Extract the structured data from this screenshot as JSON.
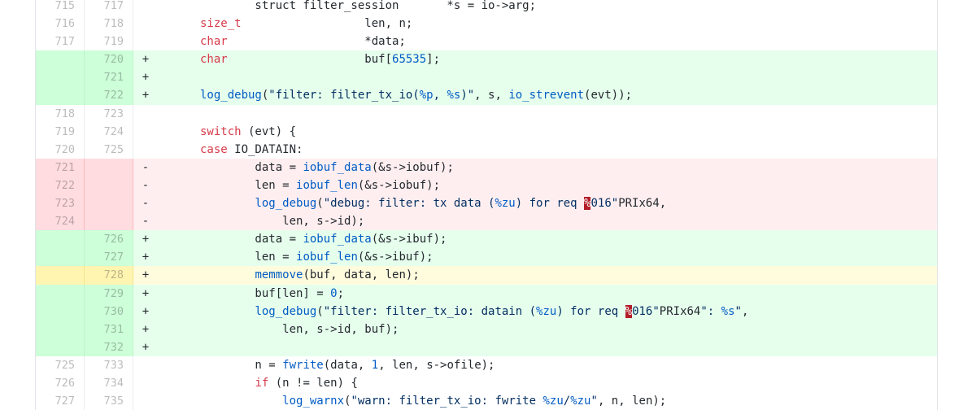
{
  "diff": {
    "rows": [
      {
        "type": "ctx",
        "old": "715",
        "new": "717",
        "marker": "",
        "tokens": [
          [
            "t",
            "        struct filter_session       *s = io->arg;"
          ]
        ]
      },
      {
        "type": "ctx",
        "old": "716",
        "new": "718",
        "marker": "",
        "tokens": [
          [
            "ty",
            "size_t"
          ],
          [
            "t",
            "                  len, n;"
          ]
        ]
      },
      {
        "type": "ctx",
        "old": "717",
        "new": "719",
        "marker": "",
        "tokens": [
          [
            "ty",
            "char"
          ],
          [
            "t",
            "                    *data;"
          ]
        ]
      },
      {
        "type": "add",
        "old": "",
        "new": "720",
        "marker": "+",
        "tokens": [
          [
            "ty",
            "char"
          ],
          [
            "t",
            "                    buf["
          ],
          [
            "n",
            "65535"
          ],
          [
            "t",
            "];"
          ]
        ]
      },
      {
        "type": "add",
        "old": "",
        "new": "721",
        "marker": "+",
        "tokens": [
          [
            "t",
            ""
          ]
        ]
      },
      {
        "type": "add",
        "old": "",
        "new": "722",
        "marker": "+",
        "tokens": [
          [
            "fn",
            "log_debug"
          ],
          [
            "t",
            "("
          ],
          [
            "s",
            "\"filter: filter_tx_io("
          ],
          [
            "n",
            "%p"
          ],
          [
            "s",
            ", "
          ],
          [
            "n",
            "%s"
          ],
          [
            "s",
            ")\""
          ],
          [
            "t",
            ", s, "
          ],
          [
            "fn",
            "io_strevent"
          ],
          [
            "t",
            "(evt));"
          ]
        ]
      },
      {
        "type": "ctx",
        "old": "718",
        "new": "723",
        "marker": "",
        "tokens": [
          [
            "t",
            ""
          ]
        ]
      },
      {
        "type": "ctx",
        "old": "719",
        "new": "724",
        "marker": "",
        "tokens": [
          [
            "k",
            "switch"
          ],
          [
            "t",
            " (evt) {"
          ]
        ]
      },
      {
        "type": "ctx",
        "old": "720",
        "new": "725",
        "marker": "",
        "tokens": [
          [
            "k",
            "case"
          ],
          [
            "t",
            " IO_DATAIN:"
          ]
        ]
      },
      {
        "type": "del",
        "old": "721",
        "new": "",
        "marker": "-",
        "tokens": [
          [
            "t",
            "        data = "
          ],
          [
            "fn",
            "iobuf_data"
          ],
          [
            "t",
            "(&s->iobuf);"
          ]
        ]
      },
      {
        "type": "del",
        "old": "722",
        "new": "",
        "marker": "-",
        "tokens": [
          [
            "t",
            "        len = "
          ],
          [
            "fn",
            "iobuf_len"
          ],
          [
            "t",
            "(&s->iobuf);"
          ]
        ]
      },
      {
        "type": "del",
        "old": "723",
        "new": "",
        "marker": "-",
        "tokens": [
          [
            "t",
            "        "
          ],
          [
            "fn",
            "log_debug"
          ],
          [
            "t",
            "("
          ],
          [
            "s",
            "\"debug: filter: tx data ("
          ],
          [
            "n",
            "%zu"
          ],
          [
            "s",
            ") for req "
          ],
          [
            "err",
            "%"
          ],
          [
            "s",
            "016\""
          ],
          [
            "t",
            "PRIx64,"
          ]
        ]
      },
      {
        "type": "del",
        "old": "724",
        "new": "",
        "marker": "-",
        "tokens": [
          [
            "t",
            "            len, s->id);"
          ]
        ]
      },
      {
        "type": "add",
        "old": "",
        "new": "726",
        "marker": "+",
        "tokens": [
          [
            "t",
            "        data = "
          ],
          [
            "fn",
            "iobuf_data"
          ],
          [
            "t",
            "(&s->ibuf);"
          ]
        ]
      },
      {
        "type": "add",
        "old": "",
        "new": "727",
        "marker": "+",
        "tokens": [
          [
            "t",
            "        len = "
          ],
          [
            "fn",
            "iobuf_len"
          ],
          [
            "t",
            "(&s->ibuf);"
          ]
        ]
      },
      {
        "type": "sel",
        "old": "",
        "new": "728",
        "marker": "+",
        "tokens": [
          [
            "t",
            "        "
          ],
          [
            "fn",
            "memmove"
          ],
          [
            "t",
            "(buf, data, len);"
          ]
        ]
      },
      {
        "type": "add",
        "old": "",
        "new": "729",
        "marker": "+",
        "tokens": [
          [
            "t",
            "        buf[len] = "
          ],
          [
            "n",
            "0"
          ],
          [
            "t",
            ";"
          ]
        ]
      },
      {
        "type": "add",
        "old": "",
        "new": "730",
        "marker": "+",
        "tokens": [
          [
            "t",
            "        "
          ],
          [
            "fn",
            "log_debug"
          ],
          [
            "t",
            "("
          ],
          [
            "s",
            "\"filter: filter_tx_io: datain ("
          ],
          [
            "n",
            "%zu"
          ],
          [
            "s",
            ") for req "
          ],
          [
            "err",
            "%"
          ],
          [
            "s",
            "016\""
          ],
          [
            "t",
            "PRIx64"
          ],
          [
            "s",
            "\": "
          ],
          [
            "n",
            "%s"
          ],
          [
            "s",
            "\""
          ],
          [
            "t",
            ","
          ]
        ]
      },
      {
        "type": "add",
        "old": "",
        "new": "731",
        "marker": "+",
        "tokens": [
          [
            "t",
            "            len, s->id, buf);"
          ]
        ]
      },
      {
        "type": "add",
        "old": "",
        "new": "732",
        "marker": "+",
        "tokens": [
          [
            "t",
            ""
          ]
        ]
      },
      {
        "type": "ctx",
        "old": "725",
        "new": "733",
        "marker": "",
        "tokens": [
          [
            "t",
            "        n = "
          ],
          [
            "fn",
            "fwrite"
          ],
          [
            "t",
            "(data, "
          ],
          [
            "n",
            "1"
          ],
          [
            "t",
            ", len, s->ofile);"
          ]
        ]
      },
      {
        "type": "ctx",
        "old": "726",
        "new": "734",
        "marker": "",
        "tokens": [
          [
            "t",
            "        "
          ],
          [
            "k",
            "if"
          ],
          [
            "t",
            " (n != len) {"
          ]
        ]
      },
      {
        "type": "ctx",
        "old": "727",
        "new": "735",
        "marker": "",
        "tokens": [
          [
            "t",
            "            "
          ],
          [
            "fn",
            "log_warnx"
          ],
          [
            "t",
            "("
          ],
          [
            "s",
            "\"warn: filter_tx_io: fwrite "
          ],
          [
            "n",
            "%zu"
          ],
          [
            "s",
            "/"
          ],
          [
            "n",
            "%zu"
          ],
          [
            "s",
            "\""
          ],
          [
            "t",
            ", n, len);"
          ]
        ]
      }
    ]
  }
}
